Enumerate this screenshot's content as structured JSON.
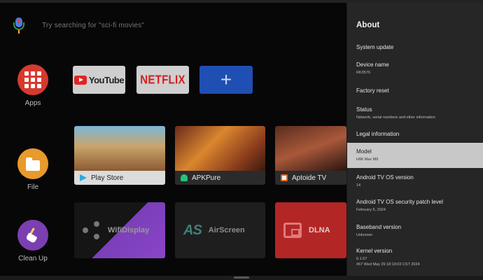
{
  "search": {
    "text": "Try searching for \"sci-fi movies\"",
    "icon": "mic-icon"
  },
  "rail": [
    {
      "label": "Apps",
      "icon": "apps-grid-icon",
      "color": "#d63a2f"
    },
    {
      "label": "File",
      "icon": "folder-icon",
      "color": "#e89a2a"
    },
    {
      "label": "Clean Up",
      "icon": "broom-icon",
      "color": "#7b3fb0"
    }
  ],
  "apps_row": [
    {
      "label": "YouTube",
      "icon": "youtube-icon"
    },
    {
      "label": "NETFLIX",
      "icon": "netflix-logo"
    },
    {
      "label": "+",
      "icon": "plus-icon"
    }
  ],
  "cards_row1": [
    {
      "label": "Play Store",
      "icon": "play-store-icon"
    },
    {
      "label": "APKPure",
      "icon": "apkpure-icon"
    },
    {
      "label": "Aptoide TV",
      "icon": "aptoide-icon"
    }
  ],
  "cards_row2": [
    {
      "label": "WifiDisplay",
      "icon": "share-icon"
    },
    {
      "label": "AirScreen",
      "icon": "airscreen-logo",
      "logo": "AS"
    },
    {
      "label": "DLNA",
      "icon": "dlna-screens-icon"
    }
  ],
  "panel": {
    "title": "About",
    "items": [
      {
        "title": "System update",
        "sub": ""
      },
      {
        "title": "Device name",
        "sub": "RK3576"
      },
      {
        "title": "Factory reset",
        "sub": ""
      },
      {
        "title": "Status",
        "sub": "Network, serial numbers and other information"
      },
      {
        "title": "Legal information",
        "sub": ""
      },
      {
        "title": "Model",
        "sub": "H96 Max M9",
        "selected": true
      },
      {
        "title": "Android TV OS version",
        "sub": "14"
      },
      {
        "title": "Android TV OS security patch level",
        "sub": "February 5, 2024"
      },
      {
        "title": "Baseband version",
        "sub": "Unknown"
      },
      {
        "title": "Kernel version",
        "sub": "6.1.57",
        "sub2": "#67 Wed May 29 18:10:03 CST 2024"
      }
    ]
  }
}
